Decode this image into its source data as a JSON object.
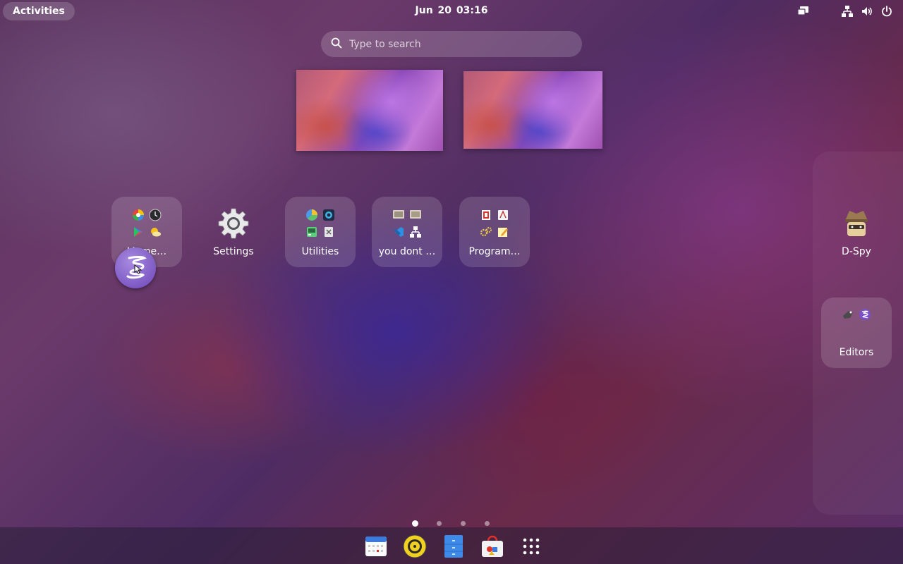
{
  "topbar": {
    "activities_label": "Activities",
    "clock": "Jun 20  03:16",
    "tray_icons": [
      "screen-share-icon",
      "network-icon",
      "volume-icon",
      "power-icon"
    ]
  },
  "search": {
    "placeholder": "Type to search"
  },
  "workspaces": [
    {
      "name": "workspace-1"
    },
    {
      "name": "workspace-2"
    }
  ],
  "app_grid": {
    "items": [
      {
        "label": "Livme…",
        "type": "folder",
        "icons": [
          "color-palette-icon",
          "clock-icon",
          "play-store-icon",
          "weather-icon"
        ]
      },
      {
        "label": "Settings",
        "type": "app",
        "icons": [
          "settings-gear-icon"
        ]
      },
      {
        "label": "Utilities",
        "type": "folder",
        "icons": [
          "disk-usage-icon",
          "camera-icon",
          "system-monitor-icon",
          "document-scanner-icon"
        ]
      },
      {
        "label": "you dont …",
        "type": "folder",
        "icons": [
          "terminal-icon",
          "screen-icon",
          "vscode-icon",
          "network-tree-icon"
        ]
      },
      {
        "label": "Program…",
        "type": "folder",
        "icons": [
          "office-icon",
          "font-viewer-icon",
          "gears-icon",
          "text-editor-icon"
        ]
      }
    ],
    "next_page": [
      {
        "label": "D-Spy",
        "type": "app",
        "icons": [
          "dspy-spy-icon"
        ]
      },
      {
        "label": "Editors",
        "type": "folder",
        "icons": [
          "gedit-icon",
          "emacs-icon"
        ]
      }
    ],
    "dragged_icon": "emacs-icon"
  },
  "pages": {
    "count": 4,
    "current": 1
  },
  "dash": {
    "items": [
      "calendar-icon",
      "rhythmbox-icon",
      "file-cabinet-icon",
      "software-store-icon",
      "show-apps-icon"
    ]
  },
  "colors": {
    "accent": "#7a4fc8",
    "folder_bg": "rgba(255,255,255,0.14)"
  }
}
